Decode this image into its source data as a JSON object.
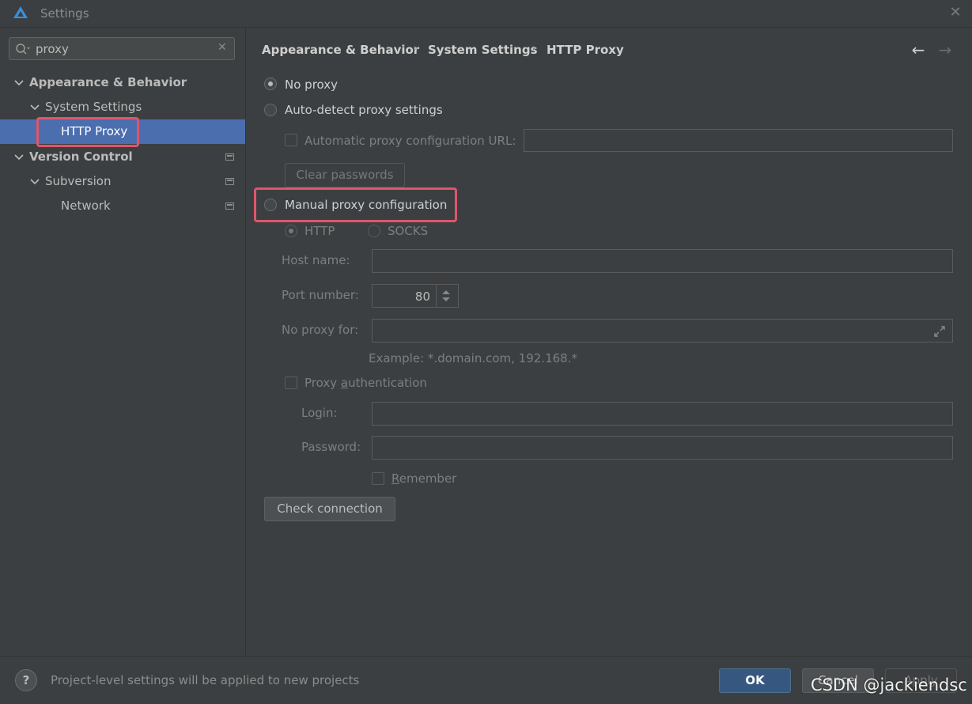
{
  "window": {
    "title": "Settings"
  },
  "sidebar": {
    "search_value": "proxy",
    "items": [
      {
        "label": "Appearance & Behavior"
      },
      {
        "label": "System Settings"
      },
      {
        "label": "HTTP Proxy"
      },
      {
        "label": "Version Control"
      },
      {
        "label": "Subversion"
      },
      {
        "label": "Network"
      }
    ]
  },
  "breadcrumb": [
    "Appearance & Behavior",
    "System Settings",
    "HTTP Proxy"
  ],
  "proxy": {
    "no_proxy": "No proxy",
    "auto_detect": "Auto-detect proxy settings",
    "auto_url": "Automatic proxy configuration URL:",
    "clear_passwords": "Clear passwords",
    "manual": "Manual proxy configuration",
    "http": "HTTP",
    "socks": "SOCKS",
    "host_label": "Host name:",
    "port_label": "Port number:",
    "port_value": "80",
    "no_proxy_for_label": "No proxy for:",
    "example": "Example: *.domain.com, 192.168.*",
    "auth_prefix": "Proxy ",
    "auth_u": "a",
    "auth_suffix": "uthentication",
    "login_label": "Login:",
    "password_label": "Password:",
    "remember_u": "R",
    "remember_rest": "emember",
    "check_connection": "Check connection"
  },
  "footer": {
    "help": "?",
    "note": "Project-level settings will be applied to new projects",
    "ok": "OK",
    "cancel": "Cancel",
    "apply": "Apply"
  },
  "watermark": "CSDN @jackiendsc",
  "colors": {
    "selection": "#4b6eaf",
    "highlight": "#e0556b",
    "ok_button": "#365880",
    "background": "#3c3f41"
  }
}
